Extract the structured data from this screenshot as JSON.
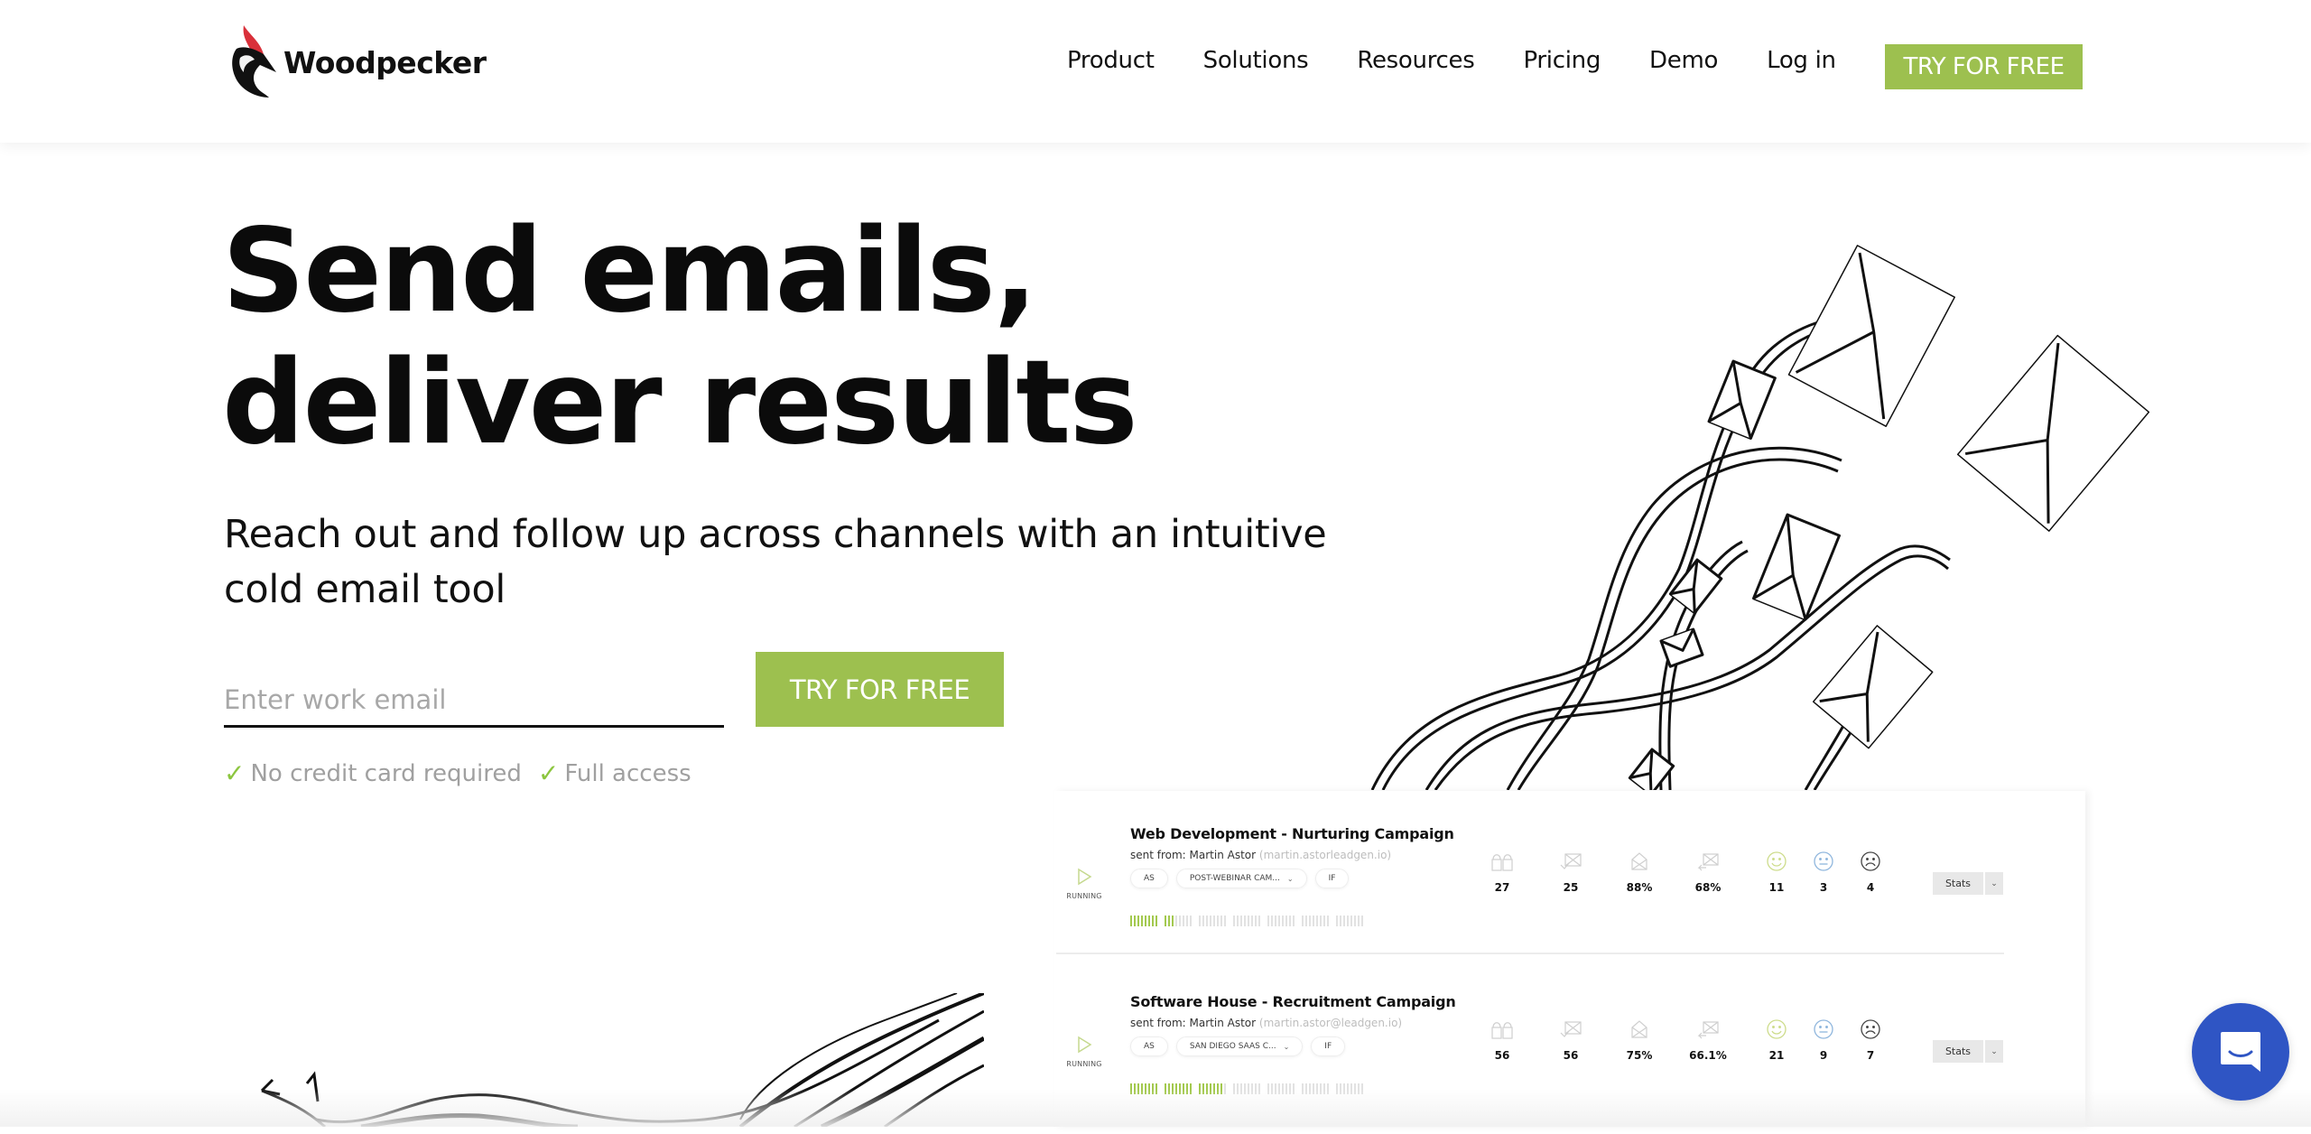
{
  "header": {
    "brand": "Woodpecker",
    "nav": [
      "Product",
      "Solutions",
      "Resources",
      "Pricing",
      "Demo",
      "Log in"
    ],
    "cta_label": "TRY FOR FREE"
  },
  "hero": {
    "title_line1": "Send emails,",
    "title_line2": "deliver results",
    "subtitle": "Reach out and follow up across channels with an intuitive cold email tool",
    "email_placeholder": "Enter work email",
    "email_value": "",
    "cta_label": "TRY FOR FREE",
    "perks": [
      "No credit card required",
      "Full access"
    ]
  },
  "campaigns": [
    {
      "title": "Web Development - Nurturing Campaign",
      "sender_prefix": "sent from: Martin Astor",
      "sender_email": "(martin.astorleadgen.io)",
      "status": "RUNNING",
      "chips": [
        "AS",
        "POST-WEBINAR CAM...",
        "IF"
      ],
      "progress_filled_ticks": 11,
      "progress_total_ticks": 56,
      "stats": {
        "prospects": "27",
        "delivered": "25",
        "opened": "88%",
        "replied": "68%",
        "interested": "11",
        "maybe_later": "3",
        "not_interested": "4"
      },
      "stats_button": "Stats"
    },
    {
      "title": "Software House - Recruitment Campaign",
      "sender_prefix": "sent from: Martin Astor",
      "sender_email": "(martin.astor@leadgen.io)",
      "status": "RUNNING",
      "chips": [
        "AS",
        "SAN DIEGO SAAS C...",
        "IF"
      ],
      "progress_filled_ticks": 23,
      "progress_total_ticks": 56,
      "stats": {
        "prospects": "56",
        "delivered": "56",
        "opened": "75%",
        "replied": "66.1%",
        "interested": "21",
        "maybe_later": "9",
        "not_interested": "7"
      },
      "stats_button": "Stats"
    }
  ],
  "icons": {
    "check": "✓",
    "caret": "⌄"
  },
  "colors": {
    "accent_green": "#9dc04f",
    "chat_blue": "#2f55c4",
    "brand_red": "#d9303a"
  }
}
